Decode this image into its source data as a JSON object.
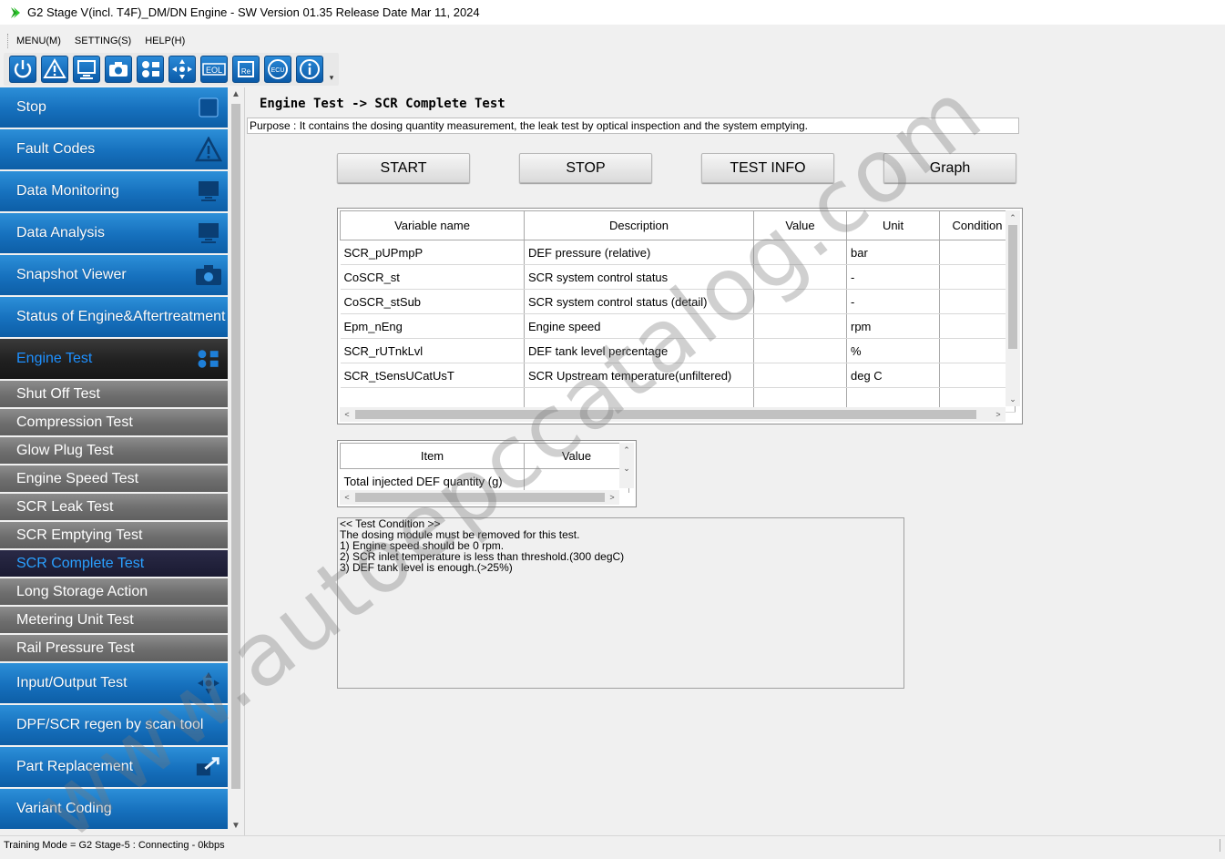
{
  "window": {
    "title": "G2 Stage V(incl. T4F)_DM/DN Engine - SW Version 01.35 Release Date Mar 11, 2024"
  },
  "menu": {
    "items": [
      "MENU(M)",
      "SETTING(S)",
      "HELP(H)"
    ]
  },
  "toolbar": {
    "icons": [
      "power-icon",
      "warning-icon",
      "monitor-icon",
      "camera-icon",
      "engine-test-icon",
      "input-output-icon",
      "eol-icon",
      "replace-icon",
      "ecu-icon",
      "info-icon"
    ],
    "eol_label": "EOL",
    "ecu_label": "ECU",
    "re_label": "Re"
  },
  "sidebar": {
    "main_items": [
      {
        "label": "Stop",
        "icon": "stop-icon"
      },
      {
        "label": "Fault Codes",
        "icon": "warning-icon"
      },
      {
        "label": "Data Monitoring",
        "icon": "monitor-icon"
      },
      {
        "label": "Data Analysis",
        "icon": "monitor-icon"
      },
      {
        "label": "Snapshot Viewer",
        "icon": "camera-icon"
      },
      {
        "label": "Status of Engine&Aftertreatment",
        "icon": ""
      },
      {
        "label": "Engine Test",
        "icon": "engine-test-icon"
      }
    ],
    "sub_items": [
      "Shut Off Test",
      "Compression Test",
      "Glow Plug Test",
      "Engine Speed Test",
      "SCR Leak Test",
      "SCR Emptying Test",
      "SCR Complete Test",
      "Long Storage Action",
      "Metering Unit Test",
      "Rail Pressure Test"
    ],
    "bottom_items": [
      {
        "label": "Input/Output Test",
        "icon": "input-output-icon"
      },
      {
        "label": "DPF/SCR regen by scan tool",
        "icon": ""
      },
      {
        "label": "Part Replacement",
        "icon": "replace-icon"
      },
      {
        "label": "Variant Coding",
        "icon": ""
      }
    ]
  },
  "main": {
    "breadcrumb": "Engine Test -> SCR Complete Test",
    "purpose": "Purpose : It contains the dosing quantity measurement, the leak test by optical inspection and the system emptying.",
    "buttons": {
      "start": "START",
      "stop": "STOP",
      "test_info": "TEST INFO",
      "graph": "Graph"
    },
    "variables": {
      "headers": [
        "Variable name",
        "Description",
        "Value",
        "Unit",
        "Condition"
      ],
      "rows": [
        [
          "SCR_pUPmpP",
          "DEF pressure (relative)",
          "",
          "bar",
          ""
        ],
        [
          "CoSCR_st",
          "SCR system control status",
          "",
          "-",
          ""
        ],
        [
          "CoSCR_stSub",
          "SCR system control status (detail)",
          "",
          "-",
          ""
        ],
        [
          "Epm_nEng",
          "Engine speed",
          "",
          "rpm",
          ""
        ],
        [
          "SCR_rUTnkLvl",
          "DEF tank level percentage",
          "",
          "%",
          ""
        ],
        [
          "SCR_tSensUCatUsT",
          "SCR Upstream temperature(unfiltered)",
          "",
          "deg C",
          ""
        ],
        [
          "",
          "",
          "",
          "",
          ""
        ]
      ]
    },
    "items": {
      "headers": [
        "Item",
        "Value"
      ],
      "rows": [
        [
          "Total injected DEF quantity (g)",
          ""
        ]
      ]
    },
    "condition": {
      "lines": [
        "<< Test Condition >>",
        "",
        "The dosing module must be removed for this test.",
        "",
        "1) Engine speed should be 0 rpm.",
        "2) SCR inlet temperature is less than threshold.(300 degC)",
        "3) DEF tank level is enough.(>25%)"
      ]
    }
  },
  "status": {
    "text": "Training Mode = G2 Stage-5 : Connecting - 0kbps"
  },
  "watermark": "www.autoepccatalog.com",
  "colors": {
    "accent_blue": "#1670bd",
    "active_text": "#1e90ff",
    "sub_gray": "#6e6e6e"
  }
}
